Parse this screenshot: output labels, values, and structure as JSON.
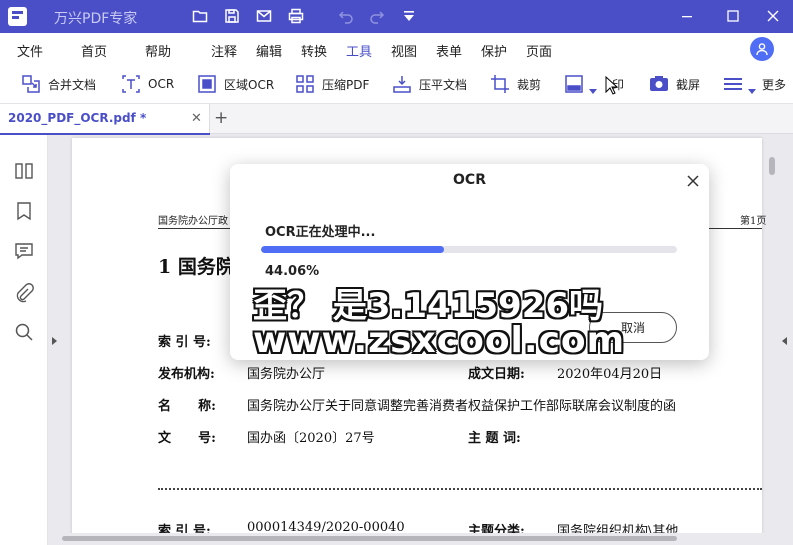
{
  "app": {
    "title": "万兴PDF专家"
  },
  "window_controls": [
    "minimize",
    "maximize",
    "close"
  ],
  "quick_toolbar": [
    "folder-open-icon",
    "save-icon",
    "mail-icon",
    "print-icon",
    "undo-icon",
    "redo-icon",
    "dropdown-icon"
  ],
  "menubar": {
    "items": [
      "文件",
      "首页",
      "帮助",
      "注释",
      "编辑",
      "转换",
      "工具",
      "视图",
      "表单",
      "保护",
      "页面"
    ],
    "active": "工具"
  },
  "tools": [
    {
      "label": "合并文档",
      "icon": "merge-icon"
    },
    {
      "label": "OCR",
      "icon": "ocr-icon"
    },
    {
      "label": "区域OCR",
      "icon": "area-ocr-icon"
    },
    {
      "label": "压缩PDF",
      "icon": "compress-icon"
    },
    {
      "label": "压平文档",
      "icon": "flatten-icon"
    },
    {
      "label": "裁剪",
      "icon": "crop-icon"
    },
    {
      "label": "印",
      "icon": "stamp-icon"
    },
    {
      "label": "截屏",
      "icon": "screenshot-icon"
    },
    {
      "label": "更多",
      "icon": "more-icon"
    }
  ],
  "tabs": [
    {
      "title": "2020_PDF_OCR.pdf *"
    }
  ],
  "sidebar": [
    "thumbnails-icon",
    "bookmark-icon",
    "comment-icon",
    "attachment-icon",
    "search-icon"
  ],
  "document": {
    "header_left": "国务院办公厅政",
    "header_right": "第1页",
    "heading": "1  国务院",
    "fields": {
      "index_label": "索 引 号:",
      "issuer_label": "发布机构:",
      "issuer_value": "国务院办公厅",
      "date_label": "成文日期:",
      "date_value": "2020年04月20日",
      "name_label": "名      称:",
      "name_value": "国务院办公厅关于同意调整完善消费者权益保护工作部际联席会议制度的函",
      "docno_label": "文      号:",
      "docno_value": "国办函〔2020〕27号",
      "subject_label": "主 题 词:",
      "index2_label": "索 引 号:",
      "index2_value": "000014349/2020-00040",
      "category_label": "主题分类:",
      "category_value": "国务院组织机构\\其他"
    }
  },
  "ocr_dialog": {
    "title": "OCR",
    "status": "OCR正在处理中...",
    "progress_text": "44.06%",
    "progress_fraction": 0.4406,
    "cancel_label": "取消"
  },
  "watermark": {
    "line1": "歪？ 是3.1415926吗",
    "line2": "www.zsxcool.com"
  },
  "colors": {
    "brand": "#4a4fc8",
    "progress": "#4f6df5"
  }
}
